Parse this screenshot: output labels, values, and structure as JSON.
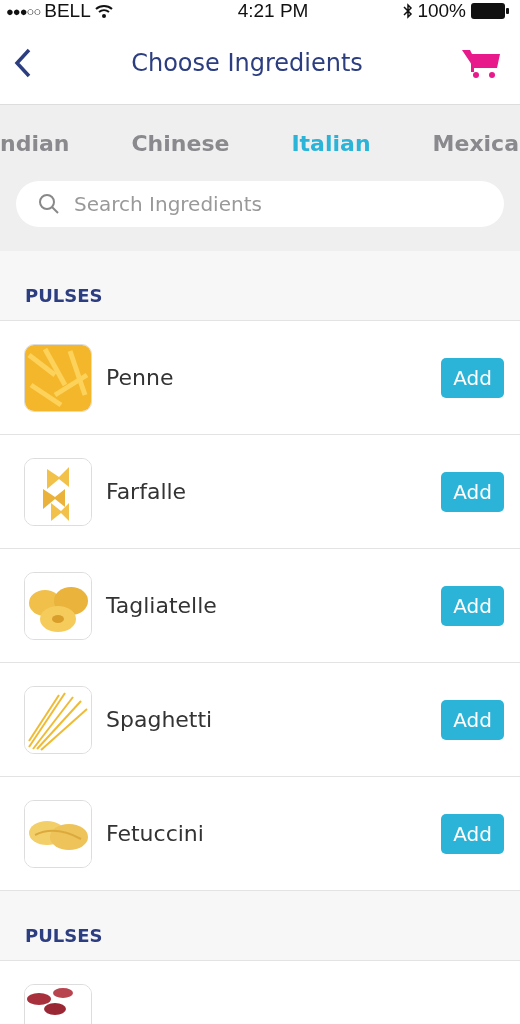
{
  "status_bar": {
    "signal": "●●●○○",
    "carrier": "BELL",
    "time": "4:21 PM",
    "battery": "100%"
  },
  "nav": {
    "title": "Choose Ingredients"
  },
  "tabs": [
    {
      "label": "ndian",
      "selected": false
    },
    {
      "label": "Chinese",
      "selected": false
    },
    {
      "label": "Italian",
      "selected": true
    },
    {
      "label": "Mexica",
      "selected": false
    }
  ],
  "search": {
    "placeholder": "Search Ingredients"
  },
  "sections": [
    {
      "title": "PULSES",
      "items": [
        {
          "name": "Penne",
          "button": "Add"
        },
        {
          "name": "Farfalle",
          "button": "Add"
        },
        {
          "name": "Tagliatelle",
          "button": "Add"
        },
        {
          "name": "Spaghetti",
          "button": "Add"
        },
        {
          "name": "Fetuccini",
          "button": "Add"
        }
      ]
    },
    {
      "title": "PULSES"
    }
  ]
}
